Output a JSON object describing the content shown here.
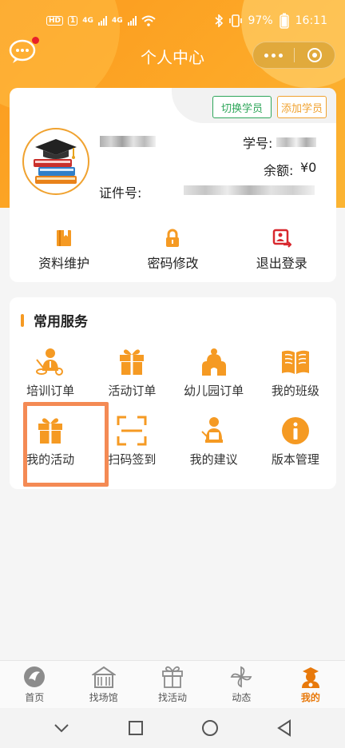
{
  "status_bar": {
    "left_badge": "HD",
    "left_badge2": "1",
    "net1": "4G",
    "net2": "4G",
    "battery": "97%",
    "time": "16:11"
  },
  "navbar": {
    "title": "个人中心"
  },
  "profile": {
    "switch_button": "切换学员",
    "add_button": "添加学员",
    "student_no_label": "学号:",
    "balance_label": "余额:",
    "balance_value": "¥0",
    "id_label": "证件号:",
    "actions": [
      {
        "label": "资料维护",
        "icon": "profile-book-icon"
      },
      {
        "label": "密码修改",
        "icon": "lock-icon"
      },
      {
        "label": "退出登录",
        "icon": "logout-icon"
      }
    ]
  },
  "services": {
    "title": "常用服务",
    "items": [
      {
        "label": "培训订单",
        "icon": "teacher-icon"
      },
      {
        "label": "活动订单",
        "icon": "gift-icon"
      },
      {
        "label": "幼儿园订单",
        "icon": "school-icon"
      },
      {
        "label": "我的班级",
        "icon": "book-open-icon"
      },
      {
        "label": "我的活动",
        "icon": "gift-icon"
      },
      {
        "label": "扫码签到",
        "icon": "scan-icon"
      },
      {
        "label": "我的建议",
        "icon": "suggestion-icon"
      },
      {
        "label": "版本管理",
        "icon": "info-icon"
      }
    ]
  },
  "tabbar": {
    "items": [
      {
        "label": "首页",
        "icon": "home-icon"
      },
      {
        "label": "找场馆",
        "icon": "venue-icon"
      },
      {
        "label": "找活动",
        "icon": "gift-icon"
      },
      {
        "label": "动态",
        "icon": "pinwheel-icon"
      },
      {
        "label": "我的",
        "icon": "me-icon",
        "active": true
      }
    ]
  },
  "colors": {
    "brand_orange": "#f59a23",
    "header_gradient": "#fb9a1e",
    "switch_green": "#2ea65a",
    "highlight": "#f48a54",
    "logout_red": "#d8282e"
  }
}
